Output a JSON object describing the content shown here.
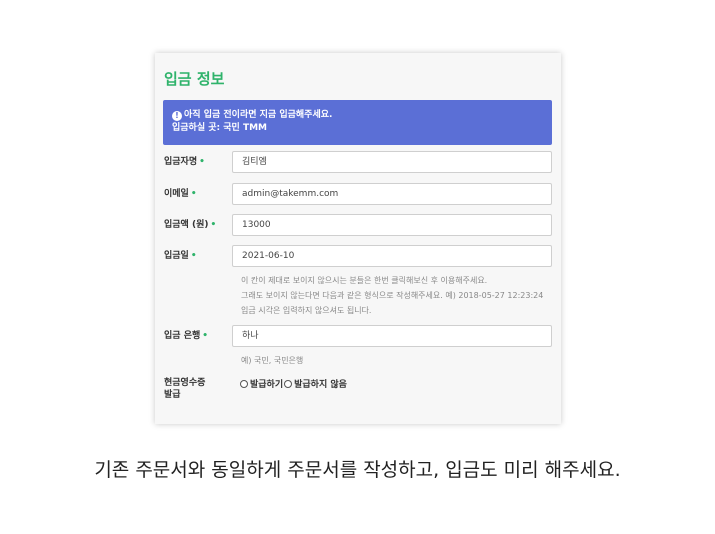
{
  "card": {
    "title": "입금 정보",
    "notice": {
      "line1": "아직 입금 전이라면 지금 입금해주세요.",
      "line2": "입금하실 곳: 국민 TMM",
      "icon": "info-icon"
    },
    "fields": {
      "depositor": {
        "label": "입금자명",
        "value": "김티엠"
      },
      "email": {
        "label": "이메일",
        "value": "admin@takemm.com"
      },
      "amount": {
        "label": "입금액 (원)",
        "value": "13000"
      },
      "date": {
        "label": "입금일",
        "value": "2021-06-10"
      },
      "bank": {
        "label": "입금 은행",
        "value": "하나"
      }
    },
    "required_marker": "•",
    "date_help": [
      "이 칸이 제대로 보이지 않으시는 분들은 한번 클릭해보신 후 이용해주세요.",
      "그래도 보이지 않는다면 다음과 같은 형식으로 작성해주세요. 예) 2018-05-27 12:23:24",
      "입금 시각은 입력하지 않으셔도 됩니다."
    ],
    "bank_help": "예) 국민, 국민은행",
    "receipt": {
      "label_line1": "현금영수증",
      "label_line2": "발급",
      "option_issue": "발급하기",
      "option_no_issue": "발급하지 않음"
    }
  },
  "caption": "기존 주문서와 동일하게 주문서를 작성하고, 입금도 미리 해주세요.",
  "colors": {
    "accent_green": "#2fb36b",
    "notice_blue": "#5b6fd6"
  }
}
